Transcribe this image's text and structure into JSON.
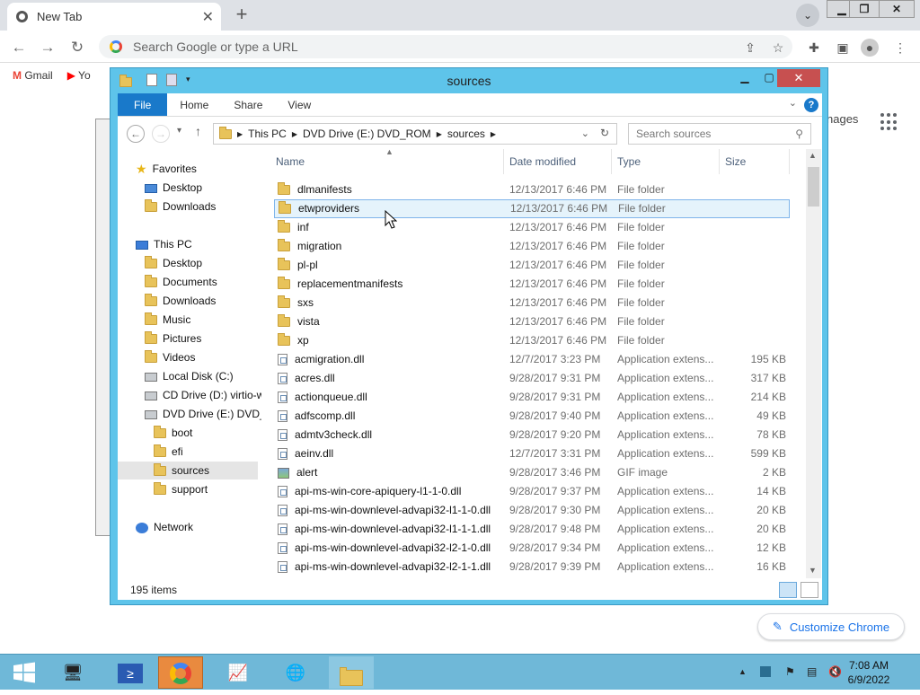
{
  "chrome": {
    "tab_title": "New Tab",
    "omnibox_placeholder": "Search Google or type a URL",
    "bookmarks": [
      "Gmail",
      "Yo"
    ],
    "content_right_text": "nages",
    "customize_label": "Customize Chrome"
  },
  "explorer": {
    "title": "sources",
    "ribbon_tabs": [
      "File",
      "Home",
      "Share",
      "View"
    ],
    "address": [
      "This PC",
      "DVD Drive (E:) DVD_ROM",
      "sources"
    ],
    "search_placeholder": "Search sources",
    "nav": [
      {
        "label": "Favorites",
        "icon": "star-icon",
        "level": 0
      },
      {
        "label": "Desktop",
        "icon": "desktop-icon",
        "level": 1
      },
      {
        "label": "Downloads",
        "icon": "folder-icon",
        "level": 1
      },
      {
        "label": "This PC",
        "icon": "pc-icon",
        "level": 0
      },
      {
        "label": "Desktop",
        "icon": "folder-icon",
        "level": 1
      },
      {
        "label": "Documents",
        "icon": "folder-icon",
        "level": 1
      },
      {
        "label": "Downloads",
        "icon": "folder-icon",
        "level": 1
      },
      {
        "label": "Music",
        "icon": "folder-icon",
        "level": 1
      },
      {
        "label": "Pictures",
        "icon": "folder-icon",
        "level": 1
      },
      {
        "label": "Videos",
        "icon": "folder-icon",
        "level": 1
      },
      {
        "label": "Local Disk (C:)",
        "icon": "disk-icon",
        "level": 1
      },
      {
        "label": "CD Drive (D:) virtio-w",
        "icon": "disk-icon",
        "level": 1
      },
      {
        "label": "DVD Drive (E:) DVD_R",
        "icon": "disk-icon",
        "level": 1
      },
      {
        "label": "boot",
        "icon": "folder-icon",
        "level": 2
      },
      {
        "label": "efi",
        "icon": "folder-icon",
        "level": 2
      },
      {
        "label": "sources",
        "icon": "folder-icon",
        "level": 2,
        "selected": true
      },
      {
        "label": "support",
        "icon": "folder-icon",
        "level": 2
      },
      {
        "label": "Network",
        "icon": "network-icon",
        "level": 0
      }
    ],
    "columns": [
      "Name",
      "Date modified",
      "Type",
      "Size"
    ],
    "rows": [
      {
        "name": "dlmanifests",
        "date": "12/13/2017 6:46 PM",
        "type": "File folder",
        "size": "",
        "icon": "folder"
      },
      {
        "name": "etwproviders",
        "date": "12/13/2017 6:46 PM",
        "type": "File folder",
        "size": "",
        "icon": "folder"
      },
      {
        "name": "inf",
        "date": "12/13/2017 6:46 PM",
        "type": "File folder",
        "size": "",
        "icon": "folder"
      },
      {
        "name": "migration",
        "date": "12/13/2017 6:46 PM",
        "type": "File folder",
        "size": "",
        "icon": "folder"
      },
      {
        "name": "pl-pl",
        "date": "12/13/2017 6:46 PM",
        "type": "File folder",
        "size": "",
        "icon": "folder"
      },
      {
        "name": "replacementmanifests",
        "date": "12/13/2017 6:46 PM",
        "type": "File folder",
        "size": "",
        "icon": "folder"
      },
      {
        "name": "sxs",
        "date": "12/13/2017 6:46 PM",
        "type": "File folder",
        "size": "",
        "icon": "folder"
      },
      {
        "name": "vista",
        "date": "12/13/2017 6:46 PM",
        "type": "File folder",
        "size": "",
        "icon": "folder"
      },
      {
        "name": "xp",
        "date": "12/13/2017 6:46 PM",
        "type": "File folder",
        "size": "",
        "icon": "folder"
      },
      {
        "name": "acmigration.dll",
        "date": "12/7/2017 3:23 PM",
        "type": "Application extens...",
        "size": "195 KB",
        "icon": "file"
      },
      {
        "name": "acres.dll",
        "date": "9/28/2017 9:31 PM",
        "type": "Application extens...",
        "size": "317 KB",
        "icon": "file"
      },
      {
        "name": "actionqueue.dll",
        "date": "9/28/2017 9:31 PM",
        "type": "Application extens...",
        "size": "214 KB",
        "icon": "file"
      },
      {
        "name": "adfscomp.dll",
        "date": "9/28/2017 9:40 PM",
        "type": "Application extens...",
        "size": "49 KB",
        "icon": "file"
      },
      {
        "name": "admtv3check.dll",
        "date": "9/28/2017 9:20 PM",
        "type": "Application extens...",
        "size": "78 KB",
        "icon": "file"
      },
      {
        "name": "aeinv.dll",
        "date": "12/7/2017 3:31 PM",
        "type": "Application extens...",
        "size": "599 KB",
        "icon": "file"
      },
      {
        "name": "alert",
        "date": "9/28/2017 3:46 PM",
        "type": "GIF image",
        "size": "2 KB",
        "icon": "gif"
      },
      {
        "name": "api-ms-win-core-apiquery-l1-1-0.dll",
        "date": "9/28/2017 9:37 PM",
        "type": "Application extens...",
        "size": "14 KB",
        "icon": "file"
      },
      {
        "name": "api-ms-win-downlevel-advapi32-l1-1-0.dll",
        "date": "9/28/2017 9:30 PM",
        "type": "Application extens...",
        "size": "20 KB",
        "icon": "file"
      },
      {
        "name": "api-ms-win-downlevel-advapi32-l1-1-1.dll",
        "date": "9/28/2017 9:48 PM",
        "type": "Application extens...",
        "size": "20 KB",
        "icon": "file"
      },
      {
        "name": "api-ms-win-downlevel-advapi32-l2-1-0.dll",
        "date": "9/28/2017 9:34 PM",
        "type": "Application extens...",
        "size": "12 KB",
        "icon": "file"
      },
      {
        "name": "api-ms-win-downlevel-advapi32-l2-1-1.dll",
        "date": "9/28/2017 9:39 PM",
        "type": "Application extens...",
        "size": "16 KB",
        "icon": "file"
      }
    ],
    "status": "195 items"
  },
  "taskbar": {
    "time": "7:08 AM",
    "date": "6/9/2022"
  },
  "colors": {
    "explorer_frame": "#5ec4ea",
    "file_tab": "#1979ca",
    "taskbar": "#6fb8d8",
    "active_app": "#e98a3f"
  }
}
